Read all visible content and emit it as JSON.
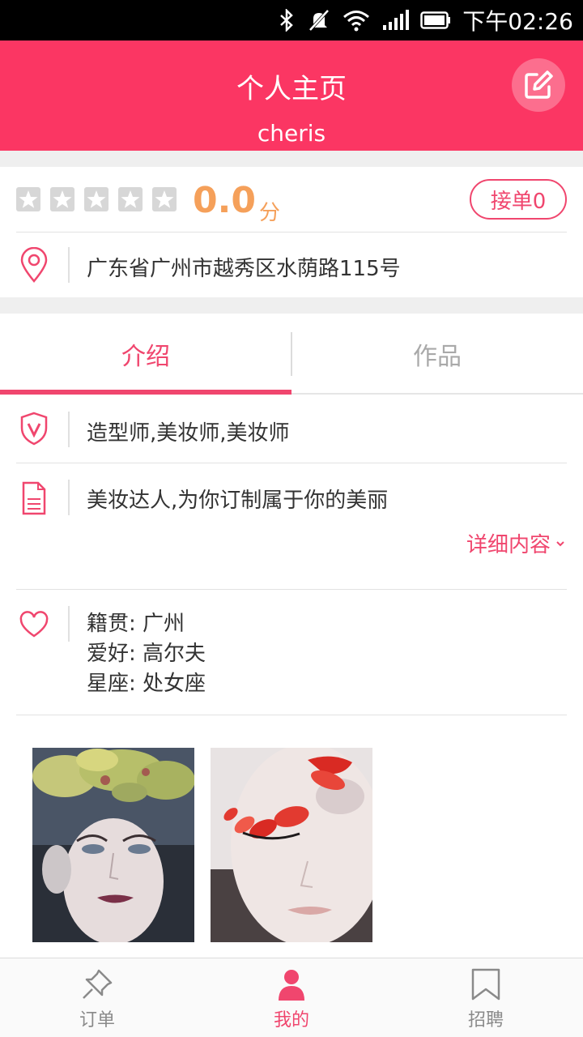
{
  "status_bar": {
    "time": "下午02:26",
    "icons": [
      "bluetooth-icon",
      "mute-icon",
      "wifi-icon",
      "signal-icon",
      "battery-icon"
    ]
  },
  "header": {
    "title": "个人主页",
    "username": "cheris",
    "color": "#fb3663"
  },
  "rating": {
    "stars_filled": 0,
    "stars_total": 5,
    "score": "0.0",
    "unit": "分",
    "order_button": "接单0"
  },
  "address": {
    "text": "广东省广州市越秀区水荫路115号"
  },
  "tabs": [
    {
      "label": "介绍",
      "active": true
    },
    {
      "label": "作品",
      "active": false
    }
  ],
  "intro": {
    "roles": "造型师,美妆师,美妆师",
    "description": "美妆达人,为你订制属于你的美丽",
    "more_label": "详细内容",
    "hometown": "籍贯: 广州",
    "hobby": "爱好: 高尔夫",
    "zodiac": "星座: 处女座"
  },
  "bottom_nav": [
    {
      "label": "订单",
      "icon": "pin-icon",
      "active": false
    },
    {
      "label": "我的",
      "icon": "person-icon",
      "active": true
    },
    {
      "label": "招聘",
      "icon": "bookmark-icon",
      "active": false
    }
  ],
  "accent_color": "#f0466e",
  "score_color": "#f5a05a"
}
